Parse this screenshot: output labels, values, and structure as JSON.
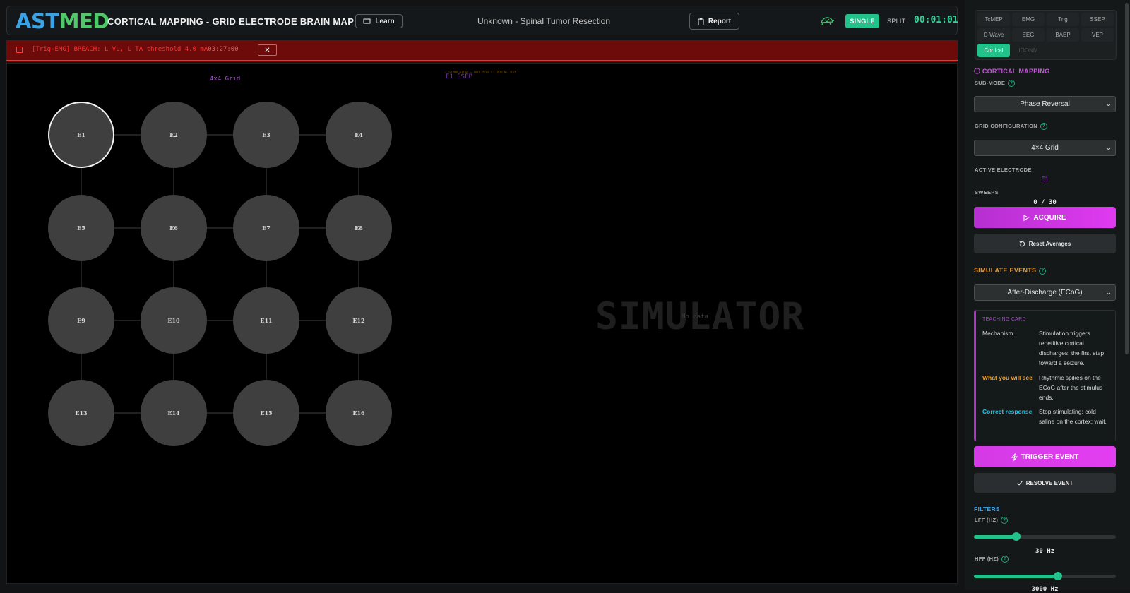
{
  "header": {
    "logo_left": "AST",
    "logo_right": "MED",
    "title": "CORTICAL MAPPING - GRID ELECTRODE BRAIN MAPPING",
    "learn_label": "Learn",
    "case": "Unknown - Spinal Tumor Resection",
    "report_label": "Report",
    "view_single": "SINGLE",
    "view_split": "SPLIT",
    "timer": "00:01:01"
  },
  "alert": {
    "text": "[Trig-EMG] BREACH: L VL, L TA threshold 4.0 mA",
    "time": "03:27:00",
    "close": "✕"
  },
  "canvas": {
    "grid_label": "4x4 Grid",
    "sim_note": "⚠ SIMULATOR — NOT FOR CLINICAL USE",
    "trace_label": "E1 SSEP",
    "watermark": "SIMULATOR",
    "no_data": "No data",
    "electrodes": [
      "E1",
      "E2",
      "E3",
      "E4",
      "E5",
      "E6",
      "E7",
      "E8",
      "E9",
      "E10",
      "E11",
      "E12",
      "E13",
      "E14",
      "E15",
      "E16"
    ],
    "active_electrode": "E1"
  },
  "modalities": [
    {
      "label": "TcMEP",
      "state": "normal"
    },
    {
      "label": "EMG",
      "state": "normal"
    },
    {
      "label": "Trig",
      "state": "normal"
    },
    {
      "label": "SSEP",
      "state": "normal"
    },
    {
      "label": "D-Wave",
      "state": "normal"
    },
    {
      "label": "EEG",
      "state": "normal"
    },
    {
      "label": "BAEP",
      "state": "normal"
    },
    {
      "label": "VEP",
      "state": "normal"
    },
    {
      "label": "Cortical",
      "state": "active"
    },
    {
      "label": "IOONM",
      "state": "dim"
    }
  ],
  "panel": {
    "section_title": "CORTICAL MAPPING",
    "submode_label": "SUB-MODE",
    "submode_value": "Phase Reversal",
    "grid_config_label": "GRID CONFIGURATION",
    "grid_config_value": "4×4 Grid",
    "active_electrode_label": "ACTIVE ELECTRODE",
    "active_electrode_value": "E1",
    "sweeps_label": "SWEEPS",
    "sweeps_value": "0 / 30",
    "acquire_label": "ACQUIRE",
    "reset_label": "Reset Averages",
    "simulate_label": "SIMULATE EVENTS",
    "simulate_value": "After-Discharge (ECoG)",
    "teaching": {
      "title": "TEACHING CARD",
      "mechanism_key": "Mechanism",
      "mechanism_val": "Stimulation triggers repetitive cortical discharges: the first step toward a seizure.",
      "see_key": "What you will see",
      "see_val": "Rhythmic spikes on the ECoG after the stimulus ends.",
      "resp_key": "Correct response",
      "resp_val": "Stop stimulating; cold saline on the cortex; wait."
    },
    "trigger_label": "TRIGGER EVENT",
    "resolve_label": "RESOLVE EVENT",
    "filters_label": "FILTERS",
    "lff_label": "LFF (HZ)",
    "lff_value": "30 Hz",
    "lff_fraction": 0.3,
    "hff_label": "HFF (HZ)",
    "hff_value": "3000 Hz",
    "hff_fraction": 0.59
  },
  "colors": {
    "accent_green": "#21c38a",
    "accent_magenta": "#d43ae6",
    "alert_red": "#ff3030",
    "see_orange": "#f0a030",
    "response_cyan": "#22c4e6"
  }
}
